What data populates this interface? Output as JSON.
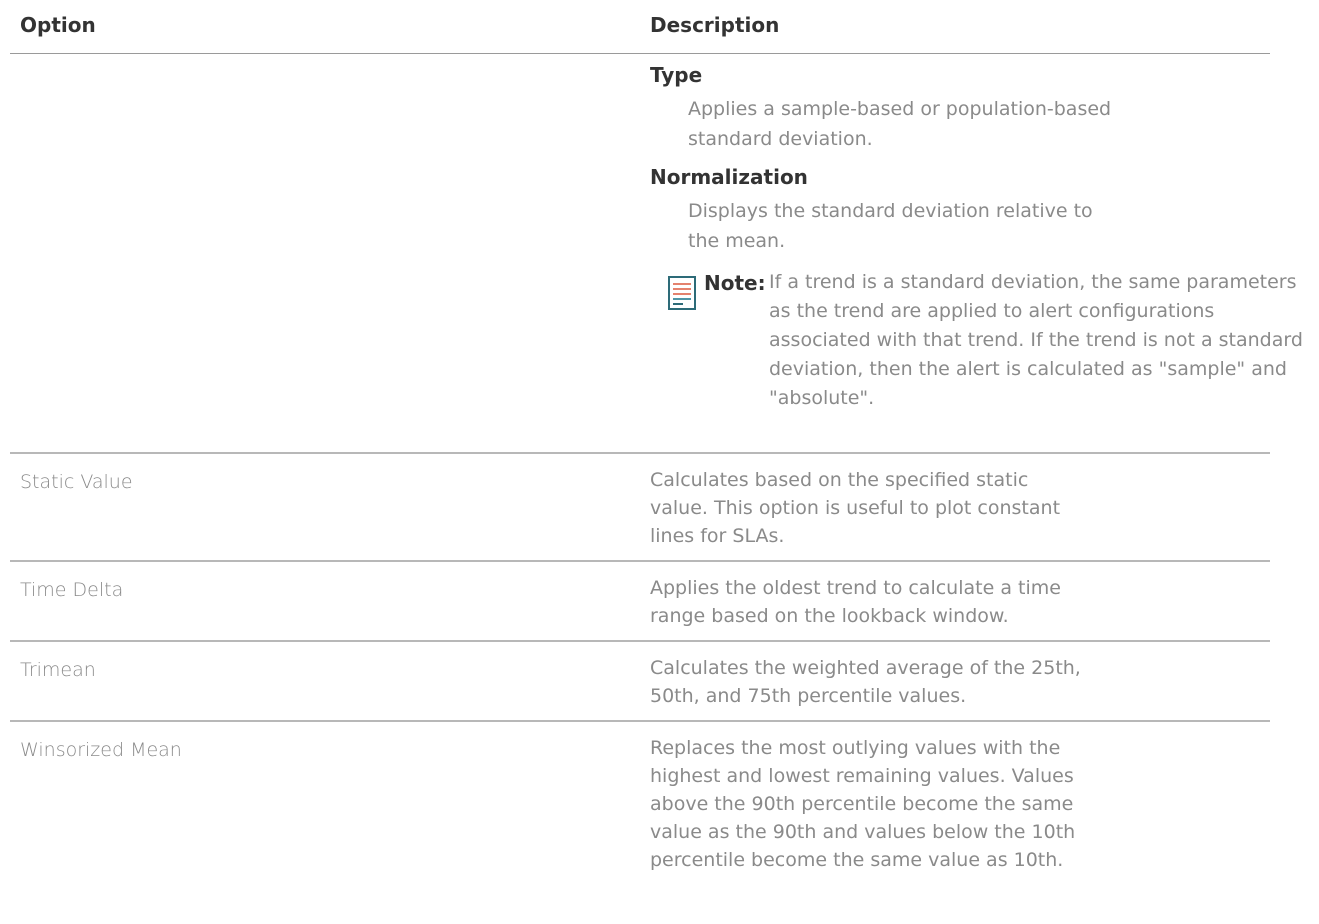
{
  "table": {
    "headers": {
      "option": "Option",
      "description": "Description"
    },
    "std_dev_options": {
      "type_term": "Type",
      "type_desc": "Applies a sample-based or population-based standard deviation.",
      "normalization_term": "Normalization",
      "normalization_desc": "Displays the standard deviation relative to the mean.",
      "note_icon": "note-icon",
      "note_label": "Note:",
      "note_text": "If a trend is a standard deviation, the same parameters as the trend are applied to alert configurations associated with that trend. If the trend is not a standard deviation, then the alert is calculated as \"sample\" and \"absolute\"."
    },
    "rows": [
      {
        "option": "Static Value",
        "description": "Calculates based on the specified static value. This option is useful to plot constant lines for SLAs."
      },
      {
        "option": "Time Delta",
        "description": "Applies the oldest trend to calculate a time range based on the lookback window."
      },
      {
        "option": "Trimean",
        "description": "Calculates the weighted average of the 25th, 50th, and 75th percentile values."
      },
      {
        "option": "Winsorized Mean",
        "description": "Replaces the most outlying values with the highest and lowest remaining values. Values above the 90th percentile become the same value as the 90th and values below the 10th percentile become the same value as 10th."
      }
    ]
  }
}
